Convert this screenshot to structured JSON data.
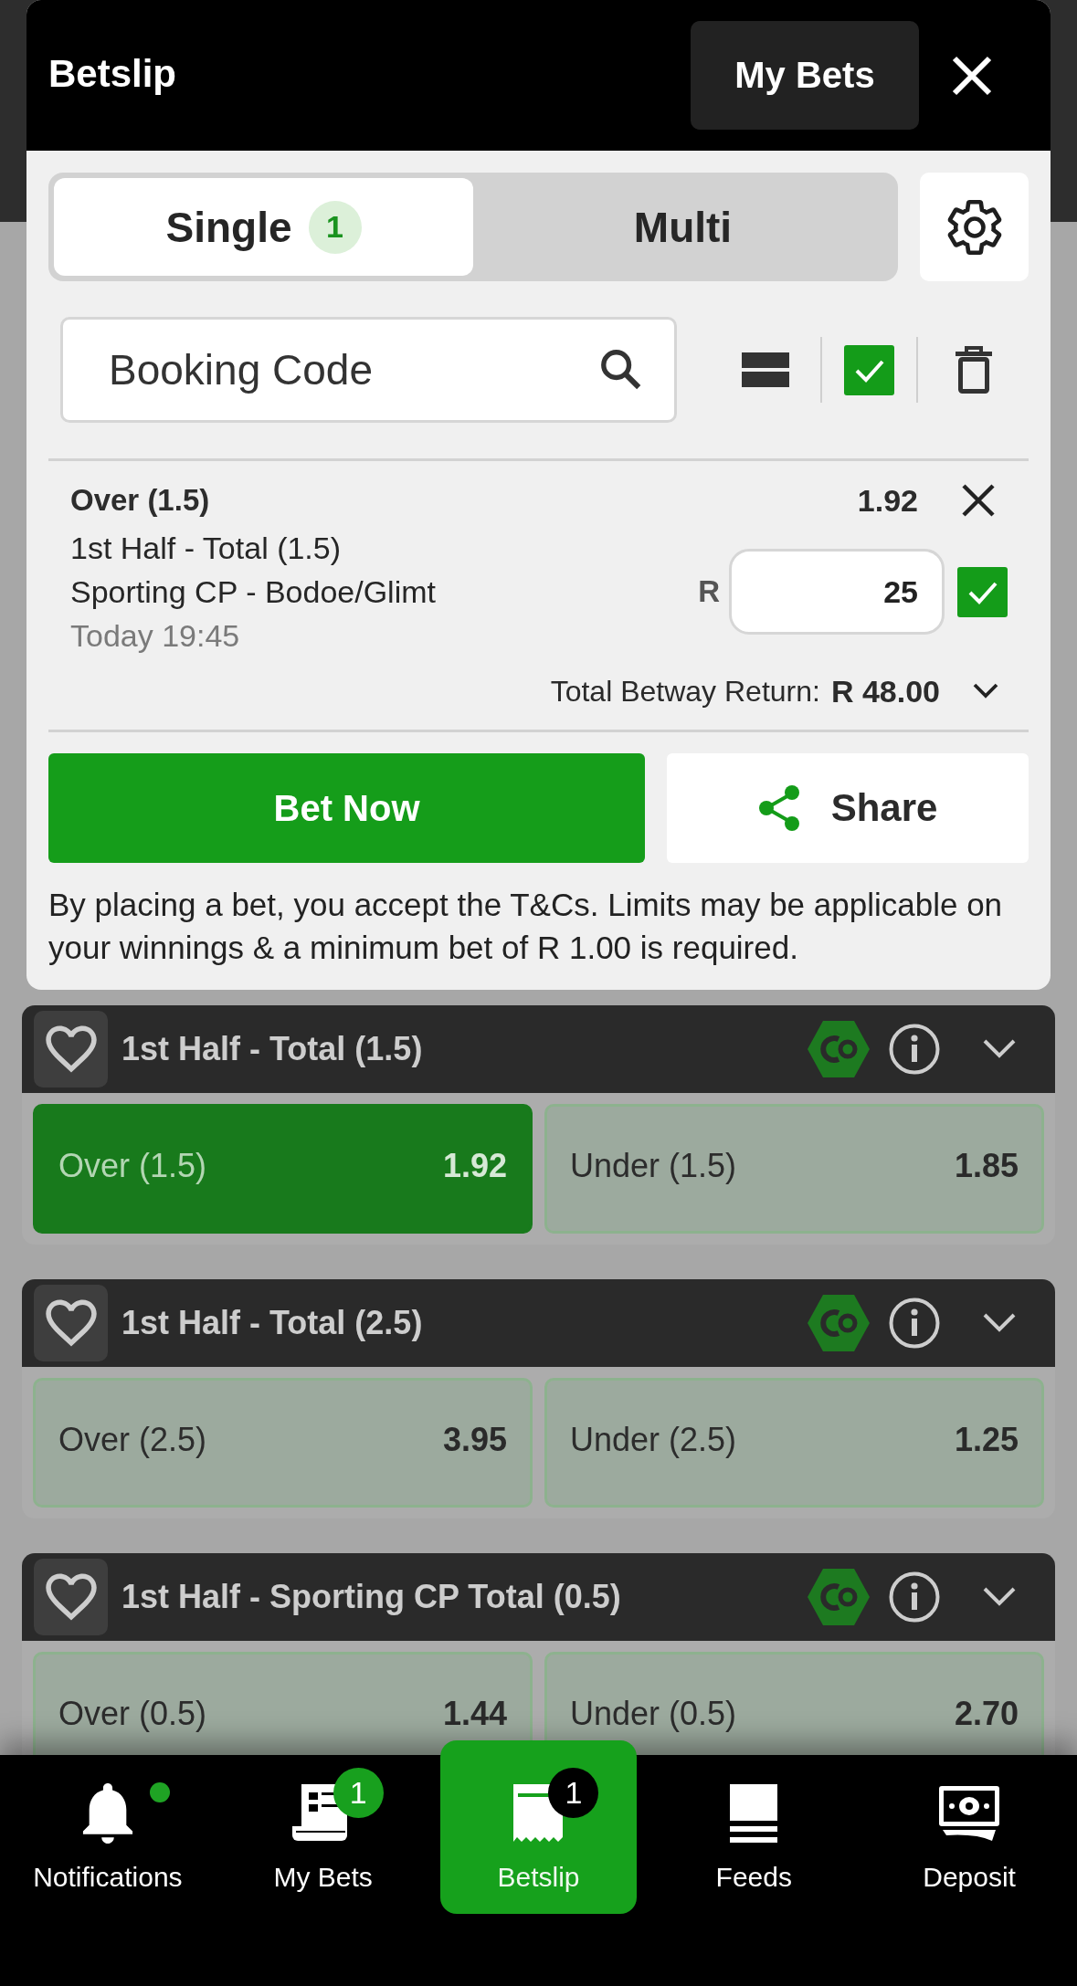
{
  "betslip": {
    "title": "Betslip",
    "my_bets_button": "My Bets",
    "tabs": [
      {
        "label": "Single",
        "count": "1",
        "selected": true
      },
      {
        "label": "Multi",
        "selected": false
      }
    ],
    "booking_code": {
      "placeholder": "Booking Code"
    },
    "select_all": {
      "checked": true
    },
    "bets": [
      {
        "selection": "Over (1.5)",
        "odds": "1.92",
        "market": "1st Half - Total (1.5)",
        "event": "Sporting CP - Bodoe/Glimt",
        "time": "Today 19:45",
        "currency": "R",
        "stake": "25",
        "checked": true
      }
    ],
    "total_return": {
      "label": "Total Betway Return:",
      "value": "R 48.00"
    },
    "bet_button": "Bet Now",
    "share_button": "Share",
    "disclaimer": "By placing a bet, you accept the T&Cs. Limits may be applicable on your winnings & a minimum bet of R 1.00 is required."
  },
  "markets": [
    {
      "title": "1st Half - Total (1.5)",
      "favorited": false,
      "outcomes": [
        {
          "label": "Over (1.5)",
          "odds": "1.92",
          "selected": true
        },
        {
          "label": "Under (1.5)",
          "odds": "1.85",
          "selected": false
        }
      ]
    },
    {
      "title": "1st Half - Total (2.5)",
      "favorited": false,
      "outcomes": [
        {
          "label": "Over (2.5)",
          "odds": "3.95",
          "selected": false
        },
        {
          "label": "Under (2.5)",
          "odds": "1.25",
          "selected": false
        }
      ]
    },
    {
      "title": "1st Half - Sporting CP Total (0.5)",
      "favorited": false,
      "outcomes": [
        {
          "label": "Over (0.5)",
          "odds": "1.44",
          "selected": false
        },
        {
          "label": "Under (0.5)",
          "odds": "2.70",
          "selected": false
        }
      ]
    }
  ],
  "bottom_nav": [
    {
      "label": "Notifications",
      "has_new": true,
      "selected": false
    },
    {
      "label": "My Bets",
      "badge": "1",
      "has_new": false,
      "selected": false
    },
    {
      "label": "Betslip",
      "badge": "1",
      "has_new": false,
      "selected": true
    },
    {
      "label": "Feeds",
      "has_new": false,
      "selected": false
    },
    {
      "label": "Deposit",
      "has_new": false,
      "selected": false
    }
  ]
}
